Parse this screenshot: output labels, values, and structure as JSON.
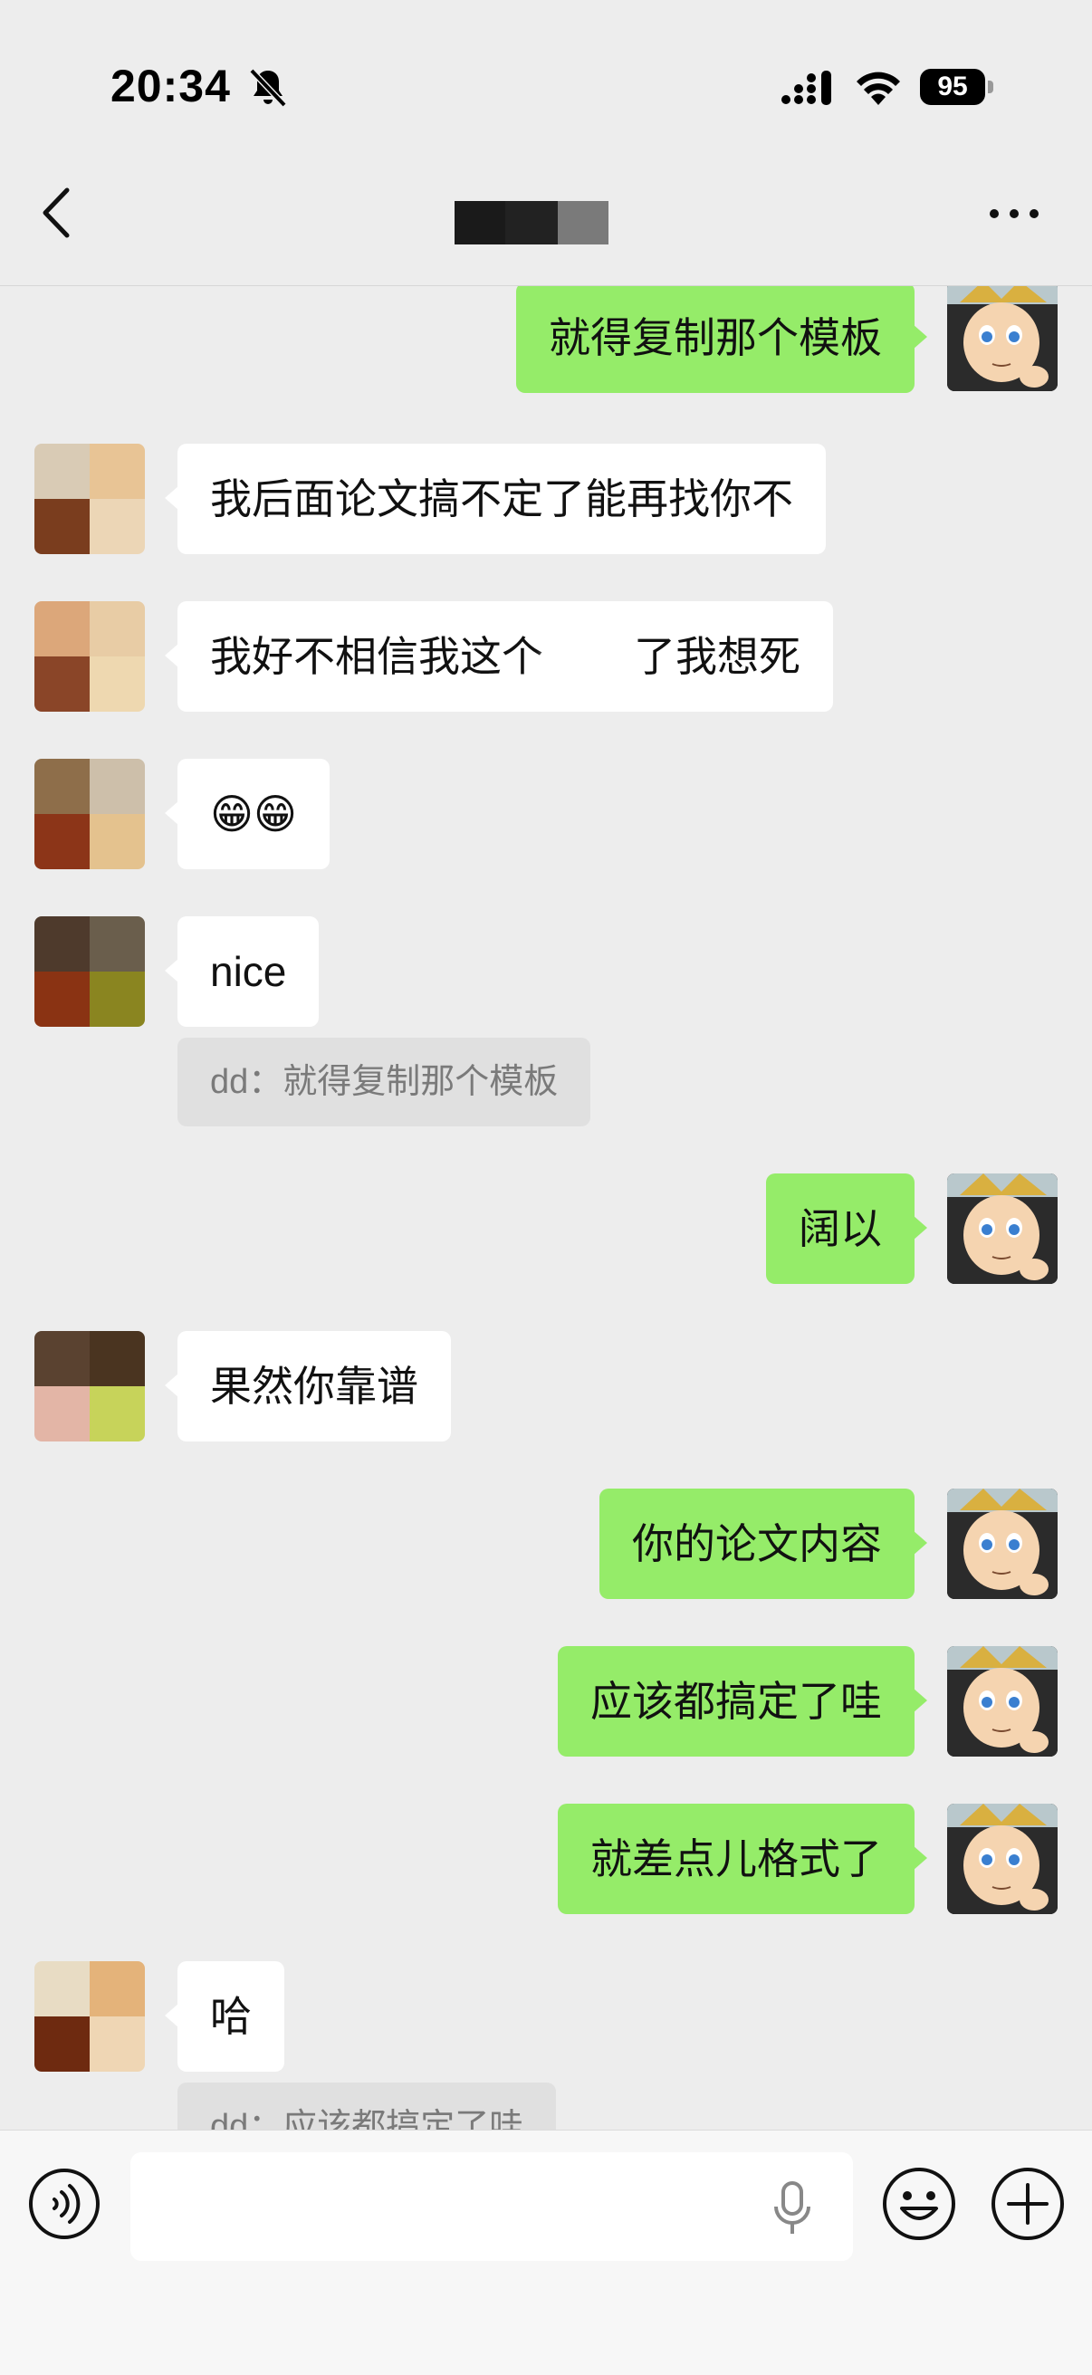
{
  "status_bar": {
    "time": "20:34",
    "battery": "95",
    "icons": [
      "bell-slash-icon",
      "cellular-signal-icon",
      "wifi-icon",
      "battery-icon"
    ]
  },
  "header": {
    "title_redacted": true,
    "back_icon": "chevron-left-icon",
    "more_icon": "ellipsis-icon"
  },
  "messages": [
    {
      "side": "out",
      "text": "就得复制那个模板"
    },
    {
      "side": "in",
      "text": "我后面论文搞不定了能再找你不"
    },
    {
      "side": "in",
      "text_before": "我好不相信我这个",
      "text_after": "了我想死",
      "redacted": true
    },
    {
      "side": "in",
      "text": "😁😁"
    },
    {
      "side": "in",
      "text": "nice",
      "quote": "dd：就得复制那个模板"
    },
    {
      "side": "out",
      "text": "阔以"
    },
    {
      "side": "in",
      "text": "果然你靠谱"
    },
    {
      "side": "out",
      "text": "你的论文内容"
    },
    {
      "side": "out",
      "text": "应该都搞定了哇"
    },
    {
      "side": "out",
      "text": "就差点儿格式了"
    },
    {
      "side": "in",
      "text": "哈",
      "quote": "dd：应该都搞定了哇"
    }
  ],
  "input_bar": {
    "placeholder": "",
    "icons": [
      "voice-icon",
      "microphone-icon",
      "emoji-icon",
      "plus-icon"
    ]
  },
  "colors": {
    "background": "#ededed",
    "outgoing_bubble": "#95ec69",
    "incoming_bubble": "#ffffff",
    "quote_bg": "#e0e0e0"
  }
}
